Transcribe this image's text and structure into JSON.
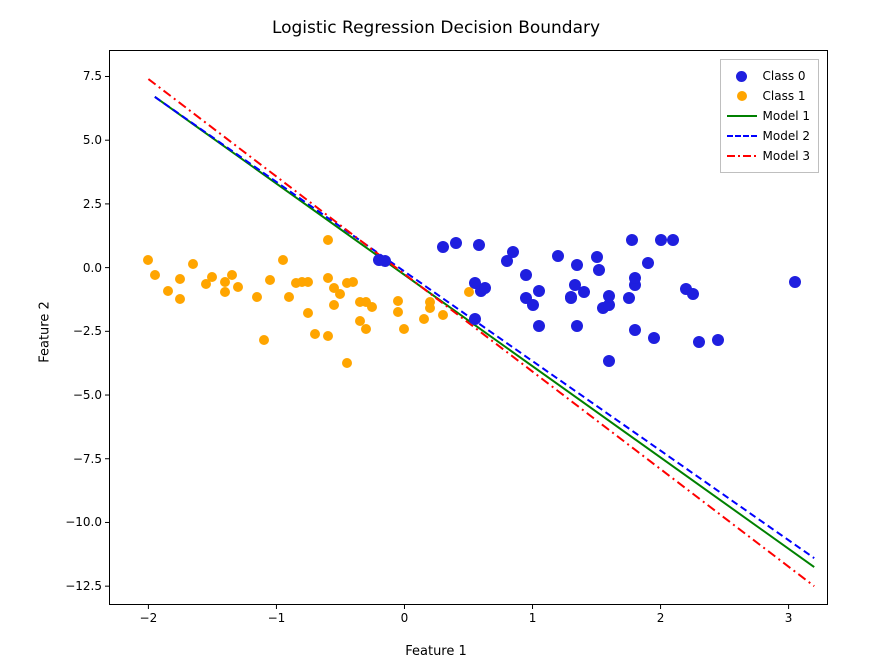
{
  "chart_data": {
    "type": "scatter",
    "title": "Logistic Regression Decision Boundary",
    "xlabel": "Feature 1",
    "ylabel": "Feature 2",
    "xlim": [
      -2.3,
      3.3
    ],
    "ylim": [
      -13.2,
      8.5
    ],
    "xticks": [
      -2,
      -1,
      0,
      1,
      2,
      3
    ],
    "yticks": [
      -12.5,
      -10.0,
      -7.5,
      -5.0,
      -2.5,
      0.0,
      2.5,
      5.0,
      7.5
    ],
    "ytick_labels": [
      "−12.5",
      "−10.0",
      "−7.5",
      "−5.0",
      "−2.5",
      "0.0",
      "2.5",
      "5.0",
      "7.5"
    ],
    "xtick_labels": [
      "−2",
      "−1",
      "0",
      "1",
      "2",
      "3"
    ],
    "legend": [
      "Class 0",
      "Class 1",
      "Model 1",
      "Model 2",
      "Model 3"
    ],
    "series": [
      {
        "name": "Class 0",
        "kind": "scatter",
        "color": "#1f1fdf",
        "points": [
          [
            0.3,
            0.8
          ],
          [
            0.4,
            0.95
          ],
          [
            0.58,
            0.9
          ],
          [
            0.55,
            -0.6
          ],
          [
            0.6,
            -0.9
          ],
          [
            0.63,
            -0.8
          ],
          [
            0.8,
            0.25
          ],
          [
            0.85,
            0.6
          ],
          [
            0.95,
            -0.3
          ],
          [
            0.95,
            -1.2
          ],
          [
            1.0,
            -1.45
          ],
          [
            1.05,
            -0.9
          ],
          [
            1.05,
            -2.3
          ],
          [
            1.2,
            0.45
          ],
          [
            1.3,
            -1.2
          ],
          [
            1.3,
            -1.15
          ],
          [
            1.33,
            -0.7
          ],
          [
            1.35,
            0.1
          ],
          [
            1.35,
            -2.3
          ],
          [
            1.4,
            -0.95
          ],
          [
            1.5,
            0.4
          ],
          [
            1.52,
            -0.1
          ],
          [
            1.55,
            -1.6
          ],
          [
            1.6,
            -1.1
          ],
          [
            1.6,
            -1.45
          ],
          [
            1.6,
            -3.65
          ],
          [
            1.75,
            -1.2
          ],
          [
            1.78,
            1.1
          ],
          [
            1.8,
            -0.7
          ],
          [
            1.8,
            -0.4
          ],
          [
            1.8,
            -2.45
          ],
          [
            1.9,
            0.2
          ],
          [
            1.95,
            -2.75
          ],
          [
            2.0,
            1.1
          ],
          [
            2.1,
            1.1
          ],
          [
            2.2,
            -0.85
          ],
          [
            2.25,
            -1.05
          ],
          [
            2.3,
            -2.9
          ],
          [
            2.45,
            -2.85
          ],
          [
            3.05,
            -0.55
          ],
          [
            -0.2,
            0.3
          ],
          [
            -0.15,
            0.25
          ],
          [
            0.55,
            -2.0
          ]
        ]
      },
      {
        "name": "Class 1",
        "kind": "scatter",
        "color": "#ffa500",
        "points": [
          [
            -2.0,
            0.3
          ],
          [
            -1.95,
            -0.3
          ],
          [
            -1.85,
            -0.9
          ],
          [
            -1.75,
            -0.45
          ],
          [
            -1.75,
            -1.25
          ],
          [
            -1.65,
            0.15
          ],
          [
            -1.55,
            -0.65
          ],
          [
            -1.5,
            -0.35
          ],
          [
            -1.4,
            -0.95
          ],
          [
            -1.4,
            -0.55
          ],
          [
            -1.35,
            -0.3
          ],
          [
            -1.3,
            -0.75
          ],
          [
            -1.15,
            -1.15
          ],
          [
            -1.1,
            -2.85
          ],
          [
            -1.05,
            -0.5
          ],
          [
            -0.95,
            0.3
          ],
          [
            -0.9,
            -1.15
          ],
          [
            -0.85,
            -0.6
          ],
          [
            -0.8,
            -0.55
          ],
          [
            -0.75,
            -0.55
          ],
          [
            -0.75,
            -1.8
          ],
          [
            -0.7,
            -2.6
          ],
          [
            -0.6,
            1.1
          ],
          [
            -0.6,
            -0.4
          ],
          [
            -0.6,
            -2.7
          ],
          [
            -0.55,
            -0.8
          ],
          [
            -0.55,
            -1.45
          ],
          [
            -0.5,
            -1.05
          ],
          [
            -0.45,
            -0.6
          ],
          [
            -0.45,
            -3.75
          ],
          [
            -0.4,
            -0.55
          ],
          [
            -0.35,
            -1.35
          ],
          [
            -0.35,
            -2.1
          ],
          [
            -0.3,
            -1.35
          ],
          [
            -0.3,
            -2.4
          ],
          [
            -0.25,
            -1.55
          ],
          [
            -0.05,
            -1.3
          ],
          [
            -0.05,
            -1.75
          ],
          [
            0.0,
            -2.4
          ],
          [
            0.15,
            -2.0
          ],
          [
            0.2,
            -1.35
          ],
          [
            0.2,
            -1.6
          ],
          [
            0.3,
            -1.85
          ],
          [
            0.5,
            -0.95
          ]
        ]
      },
      {
        "name": "Model 1",
        "kind": "line",
        "color": "#008000",
        "style": "solid",
        "points": [
          [
            -1.95,
            6.7
          ],
          [
            3.2,
            -11.75
          ]
        ]
      },
      {
        "name": "Model 2",
        "kind": "line",
        "color": "#0000ff",
        "style": "dashed",
        "points": [
          [
            -1.95,
            6.7
          ],
          [
            3.2,
            -11.4
          ]
        ]
      },
      {
        "name": "Model 3",
        "kind": "line",
        "color": "#ff0000",
        "style": "dashdot",
        "points": [
          [
            -2.0,
            7.4
          ],
          [
            3.2,
            -12.5
          ]
        ]
      }
    ]
  }
}
